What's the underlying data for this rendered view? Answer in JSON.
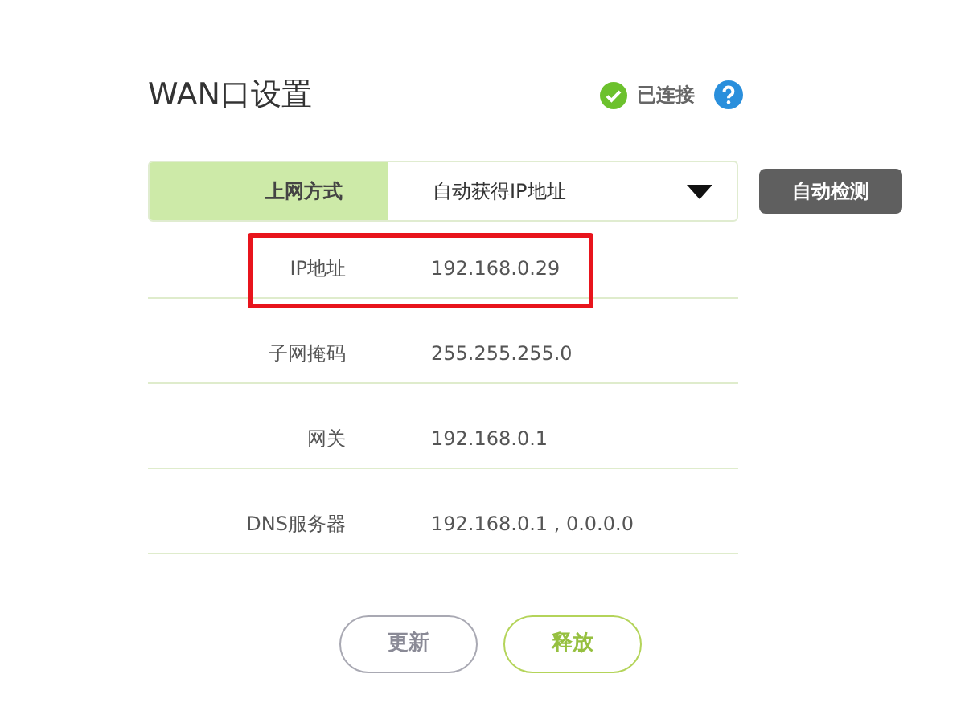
{
  "title": "WAN口设置",
  "status": {
    "text": "已连接",
    "connected": true
  },
  "connection_type": {
    "label": "上网方式",
    "value": "自动获得IP地址"
  },
  "detect_button": "自动检测",
  "fields": [
    {
      "label": "IP地址",
      "value": "192.168.0.29",
      "highlighted": true
    },
    {
      "label": "子网掩码",
      "value": "255.255.255.0",
      "highlighted": false
    },
    {
      "label": "网关",
      "value": "192.168.0.1",
      "highlighted": false
    },
    {
      "label": "DNS服务器",
      "value": "192.168.0.1 , 0.0.0.0",
      "highlighted": false
    }
  ],
  "buttons": [
    {
      "label": "更新",
      "kind": "secondary"
    },
    {
      "label": "释放",
      "kind": "primary"
    }
  ]
}
